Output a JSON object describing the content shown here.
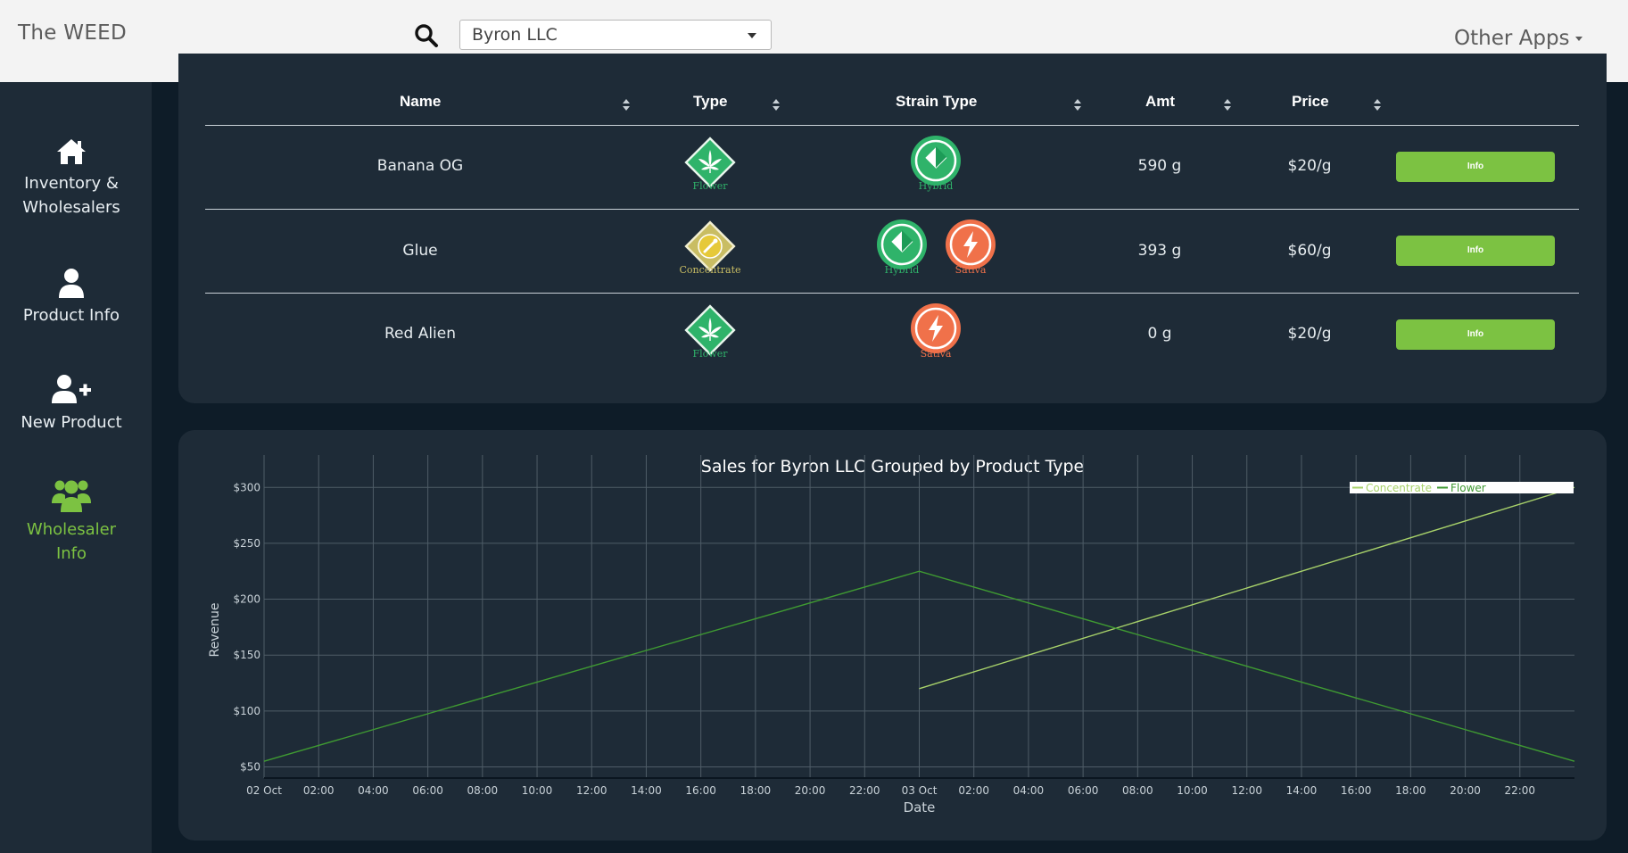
{
  "header": {
    "brand": "The WEED",
    "company_select": {
      "value": "Byron LLC"
    },
    "other_apps": "Other Apps"
  },
  "sidebar": {
    "items": [
      {
        "label_line1": "Inventory &",
        "label_line2": "Wholesalers",
        "icon": "home-icon",
        "active": false
      },
      {
        "label_line1": "Product Info",
        "label_line2": "",
        "icon": "user-icon",
        "active": false
      },
      {
        "label_line1": "New Product",
        "label_line2": "",
        "icon": "user-plus-icon",
        "active": false
      },
      {
        "label_line1": "Wholesaler",
        "label_line2": "Info",
        "icon": "users-icon",
        "active": true
      }
    ]
  },
  "table": {
    "columns": [
      "Name",
      "Type",
      "Strain Type",
      "Amt",
      "Price"
    ],
    "rows": [
      {
        "name": "Banana OG",
        "type": "Flower",
        "strains": [
          "Hybrid"
        ],
        "amt": "590 g",
        "price": "$20/g",
        "action": "Info"
      },
      {
        "name": "Glue",
        "type": "Concentrate",
        "strains": [
          "Hybrid",
          "Sativa"
        ],
        "amt": "393 g",
        "price": "$60/g",
        "action": "Info"
      },
      {
        "name": "Red Alien",
        "type": "Flower",
        "strains": [
          "Sativa"
        ],
        "amt": "0 g",
        "price": "$20/g",
        "action": "Info"
      }
    ]
  },
  "colors": {
    "accent": "#7cc242",
    "flower": "#2fb36a",
    "concentrate": "#c9bd63",
    "hybrid": "#2fb36a",
    "sativa": "#f0714a",
    "panel": "#1e2b37",
    "background": "#0e1c28"
  },
  "chart_data": {
    "type": "line",
    "title": "Sales for Byron LLC Grouped by Product Type",
    "xlabel": "Date",
    "ylabel": "Revenue",
    "x_tick_labels": [
      "02 Oct",
      "02:00",
      "04:00",
      "06:00",
      "08:00",
      "10:00",
      "12:00",
      "14:00",
      "16:00",
      "18:00",
      "20:00",
      "22:00",
      "03 Oct",
      "02:00",
      "04:00",
      "06:00",
      "08:00",
      "10:00",
      "12:00",
      "14:00",
      "16:00",
      "18:00",
      "20:00",
      "22:00"
    ],
    "y_tick_labels": [
      "$50",
      "$100",
      "$150",
      "$200",
      "$250",
      "$300"
    ],
    "x_range_hours": [
      0,
      48
    ],
    "ylim": [
      40,
      305
    ],
    "grid": true,
    "legend_position": "top-right",
    "series": [
      {
        "name": "Concentrate",
        "color": "#a8d26a",
        "x_hours": [
          24,
          48
        ],
        "values": [
          120,
          300
        ]
      },
      {
        "name": "Flower",
        "color": "#3f9a32",
        "x_hours": [
          0,
          24,
          48
        ],
        "values": [
          55,
          225,
          55
        ]
      }
    ]
  }
}
